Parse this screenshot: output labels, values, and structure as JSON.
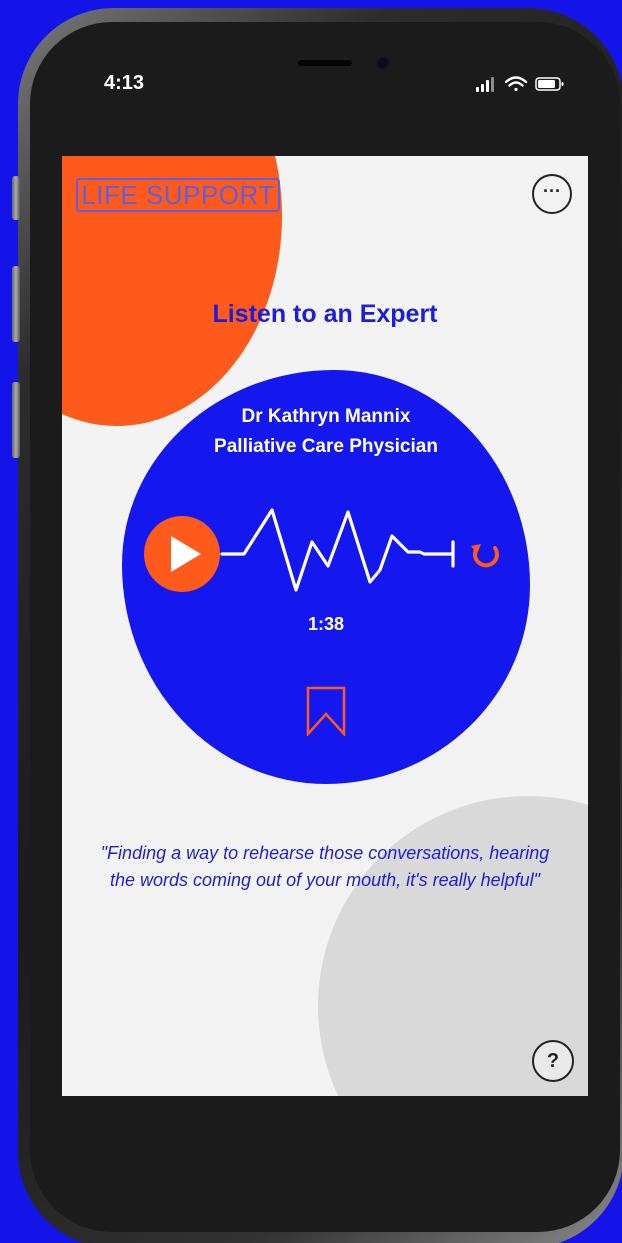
{
  "status_bar": {
    "time": "4:13"
  },
  "app": {
    "logo_text": "LIFE SUPPORT",
    "more_label": "···",
    "title": "Listen to an Expert"
  },
  "expert": {
    "name": "Dr Kathryn Mannix",
    "role": "Palliative Care Physician"
  },
  "player": {
    "duration": "1:38",
    "play_icon": "play-icon",
    "replay_icon": "replay-icon",
    "bookmark_icon": "bookmark-icon"
  },
  "quote": {
    "text": "\"Finding a way to rehearse those conversations, hearing the words coming out of your mouth, it's really helpful\""
  },
  "help": {
    "label": "?"
  },
  "colors": {
    "background": "#1414e8",
    "brand_blue": "#1417ee",
    "accent_orange": "#fe5a1c",
    "screen_bg": "#f3f3f3",
    "grey_blob": "#d9d9d9"
  }
}
